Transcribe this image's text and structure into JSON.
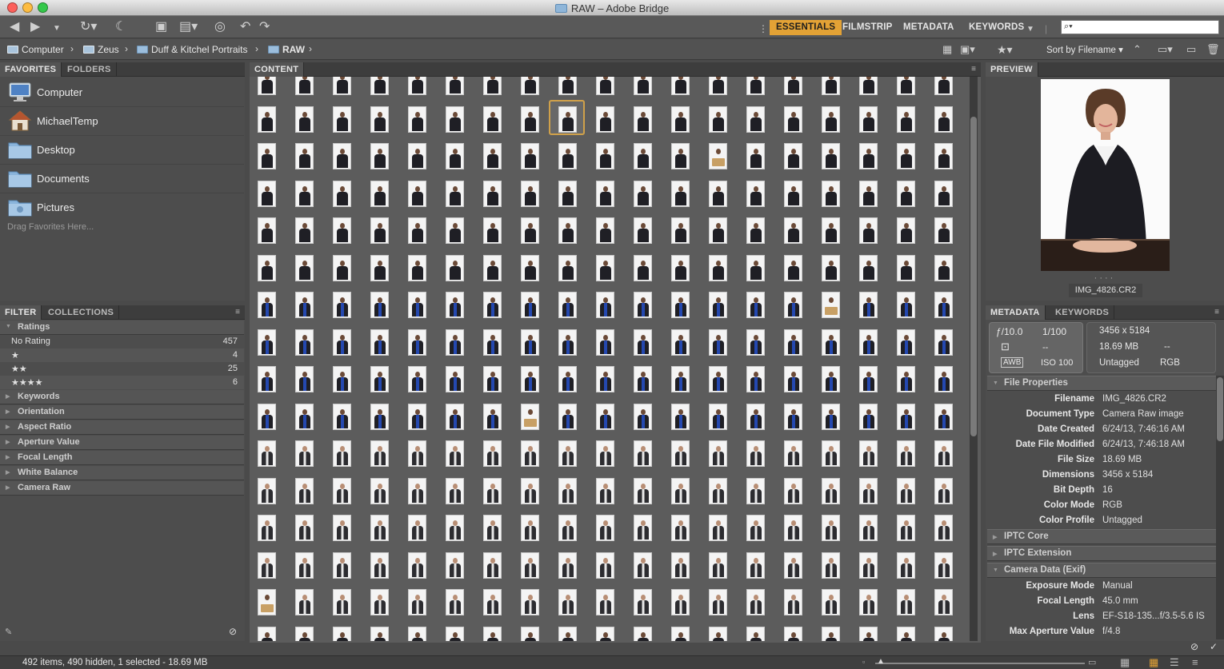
{
  "window": {
    "title": "RAW – Adobe Bridge"
  },
  "workspaces": [
    {
      "label": "ESSENTIALS",
      "active": true
    },
    {
      "label": "FILMSTRIP",
      "active": false
    },
    {
      "label": "METADATA",
      "active": false
    },
    {
      "label": "KEYWORDS",
      "active": false
    }
  ],
  "search": {
    "placeholder": "⌕▾"
  },
  "path": [
    "Computer",
    "Zeus",
    "Duff & Kitchel Portraits",
    "RAW"
  ],
  "sort": {
    "label": "Sort by Filename ▾"
  },
  "left_tabs": {
    "favorites": "FAVORITES",
    "folders": "FOLDERS"
  },
  "favorites": [
    "Computer",
    "MichaelTemp",
    "Desktop",
    "Documents",
    "Pictures"
  ],
  "favorites_hint": "Drag Favorites Here...",
  "filter_tabs": {
    "filter": "FILTER",
    "collections": "COLLECTIONS"
  },
  "filter": {
    "ratings_title": "Ratings",
    "ratings": [
      {
        "label": "No Rating",
        "count": "457"
      },
      {
        "label": "★",
        "count": "4"
      },
      {
        "label": "★★",
        "count": "25"
      },
      {
        "label": "★★★★",
        "count": "6"
      }
    ],
    "groups": [
      "Keywords",
      "Orientation",
      "Aspect Ratio",
      "Aperture Value",
      "Focal Length",
      "White Balance",
      "Camera Raw"
    ]
  },
  "content_tab": "CONTENT",
  "preview_tab": "PREVIEW",
  "preview": {
    "filename": "IMG_4826.CR2"
  },
  "meta_tabs": {
    "metadata": "METADATA",
    "keywords": "KEYWORDS"
  },
  "placard": {
    "fstop": "ƒ/10.0",
    "shutter": "1/100",
    "dash1": "--",
    "awb": "AWB",
    "iso": "ISO 100",
    "dimensions": "3456 x 5184",
    "size": "18.69 MB",
    "dash2": "--",
    "tag": "Untagged",
    "mode": "RGB"
  },
  "file_properties_title": "File Properties",
  "file_properties": [
    {
      "k": "Filename",
      "v": "IMG_4826.CR2"
    },
    {
      "k": "Document Type",
      "v": "Camera Raw image"
    },
    {
      "k": "Date Created",
      "v": "6/24/13, 7:46:16 AM"
    },
    {
      "k": "Date File Modified",
      "v": "6/24/13, 7:46:18 AM"
    },
    {
      "k": "File Size",
      "v": "18.69 MB"
    },
    {
      "k": "Dimensions",
      "v": "3456 x 5184"
    },
    {
      "k": "Bit Depth",
      "v": "16"
    },
    {
      "k": "Color Mode",
      "v": "RGB"
    },
    {
      "k": "Color Profile",
      "v": "Untagged"
    }
  ],
  "iptc_core": "IPTC Core",
  "iptc_ext": "IPTC Extension",
  "camera_title": "Camera Data (Exif)",
  "camera": [
    {
      "k": "Exposure Mode",
      "v": "Manual"
    },
    {
      "k": "Focal Length",
      "v": "45.0 mm"
    },
    {
      "k": "Lens",
      "v": "EF-S18-135...f/3.5-5.6 IS"
    },
    {
      "k": "Max Aperture Value",
      "v": "f/4.8"
    }
  ],
  "status": "492 items, 490 hidden, 1 selected - 18.69 MB"
}
